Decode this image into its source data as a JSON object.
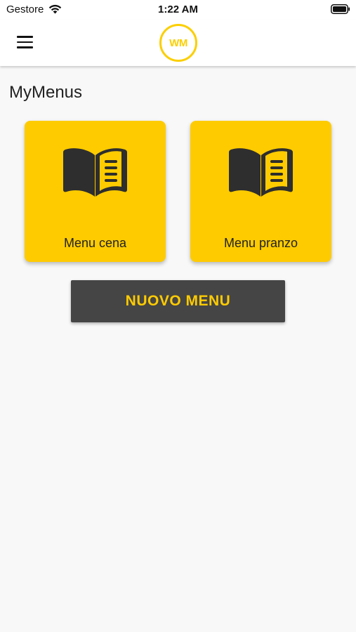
{
  "status_bar": {
    "carrier": "Gestore",
    "time": "1:22 AM"
  },
  "header": {
    "logo_text": "WM",
    "menu_icon": "hamburger-icon"
  },
  "page": {
    "title": "MyMenus"
  },
  "cards": [
    {
      "label": "Menu cena",
      "icon": "open-book-icon"
    },
    {
      "label": "Menu pranzo",
      "icon": "open-book-icon"
    }
  ],
  "actions": {
    "new_menu_label": "NUOVO MENU"
  },
  "colors": {
    "accent": "#fecb00",
    "button_bg": "#454545",
    "icon_dark": "#2e2e2e",
    "background": "#f8f8f8"
  }
}
